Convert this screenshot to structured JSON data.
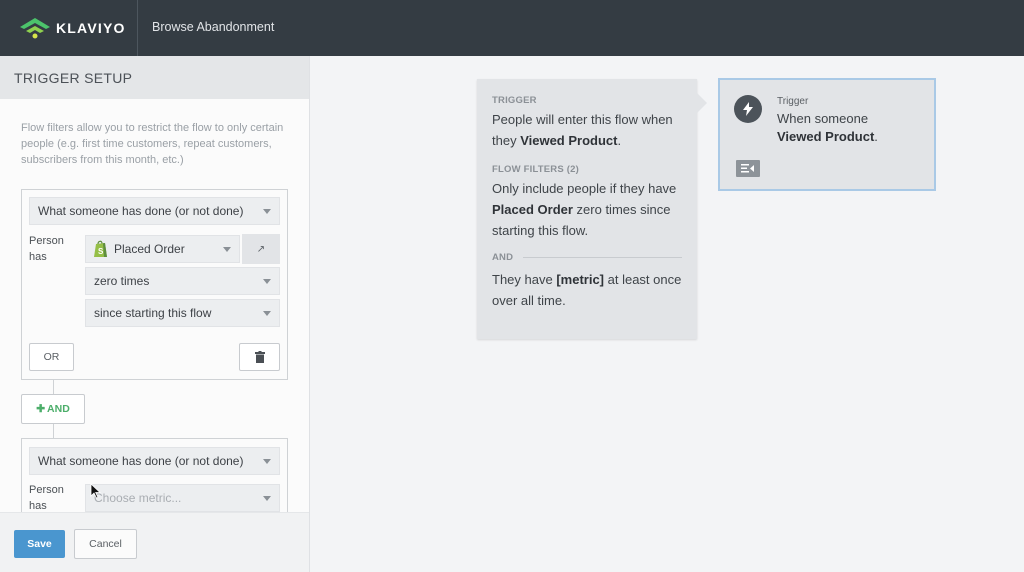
{
  "app": {
    "brand": "KLAVIYO",
    "flow_name": "Browse Abandonment"
  },
  "panel": {
    "title": "TRIGGER SETUP",
    "description": "Flow filters allow you to restrict the flow to only certain people (e.g. first time customers, repeat customers, subscribers from this month, etc.)",
    "filters": [
      {
        "type_select": "What someone has done (or not done)",
        "person_has_label_line1": "Person",
        "person_has_label_line2": "has",
        "metric_select": "Placed Order",
        "metric_icon": "shopify-icon",
        "frequency_select": "zero times",
        "timeframe_select": "since starting this flow",
        "or_label": "OR",
        "delete_icon": "trash-icon"
      },
      {
        "type_select": "What someone has done (or not done)",
        "person_has_label_line1": "Person",
        "person_has_label_line2": "has",
        "metric_placeholder": "Choose metric..."
      }
    ],
    "and_label": "AND",
    "and_icon": "plus-icon",
    "save_label": "Save",
    "cancel_label": "Cancel"
  },
  "summary": {
    "trigger_heading": "TRIGGER",
    "trigger_text_prefix": "People will enter this flow when they ",
    "trigger_metric": "Viewed Product",
    "trigger_text_suffix": ".",
    "filters_heading": "FLOW FILTERS (2)",
    "filter1_prefix": "Only include people if they have ",
    "filter1_metric": "Placed Order",
    "filter1_suffix": " zero times since starting this flow.",
    "and_heading": "AND",
    "filter2_prefix": "They have ",
    "filter2_metric": "[metric]",
    "filter2_suffix": " at least once over all time."
  },
  "trigger_card": {
    "label": "Trigger",
    "text_prefix": "When someone",
    "metric": "Viewed Product",
    "suffix": ".",
    "icon": "lightning-bolt-icon"
  },
  "colors": {
    "topbar": "#343c43",
    "primary": "#4a96cf",
    "and_green": "#4cae6a",
    "selected_border": "#a9c9e6"
  }
}
